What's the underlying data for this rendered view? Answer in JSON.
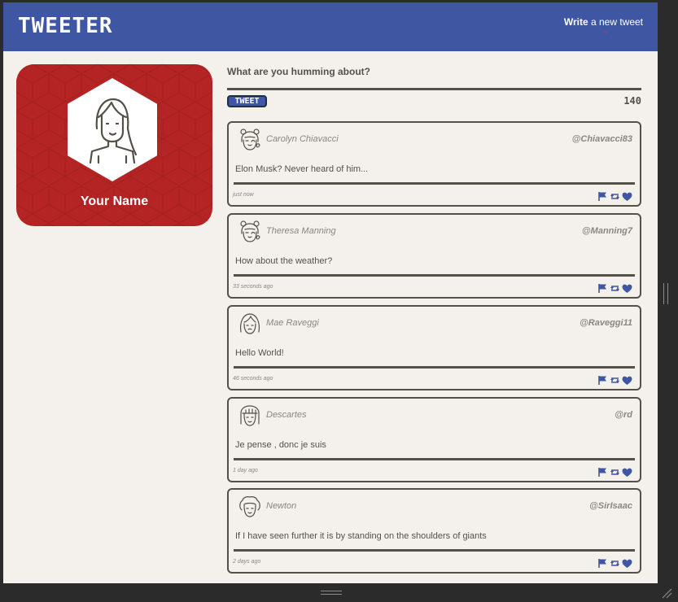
{
  "header": {
    "brand": "TWEETER",
    "write_bold": "Write",
    "write_rest": " a new tweet",
    "arrow": "⌄"
  },
  "profile": {
    "name": "Your Name"
  },
  "compose": {
    "label": "What are you humming about?",
    "placeholder": "",
    "button_label": "TWEET",
    "counter": "140"
  },
  "tweets": [
    {
      "name": "Carolyn Chiavacci",
      "handle": "@Chiavacci83",
      "content": "Elon Musk? Never heard of him...",
      "time": "just now"
    },
    {
      "name": "Theresa Manning",
      "handle": "@Manning7",
      "content": "How about the weather?",
      "time": "33 seconds ago"
    },
    {
      "name": "Mae Raveggi",
      "handle": "@Raveggi11",
      "content": "Hello World!",
      "time": "46 seconds ago"
    },
    {
      "name": "Descartes",
      "handle": "@rd",
      "content": "Je pense , donc je suis",
      "time": "1 day ago"
    },
    {
      "name": "Newton",
      "handle": "@SirIsaac",
      "content": "If I have seen further it is by standing on the shoulders of giants",
      "time": "2 days ago"
    }
  ],
  "icons": {
    "flag": "flag-icon",
    "retweet": "retweet-icon",
    "like": "heart-icon",
    "avatar": "avatar-icon"
  },
  "colors": {
    "navbar": "#3f57a2",
    "profile_bg": "#b52424",
    "page_bg": "#f4f1ec",
    "text_dark": "#545149",
    "text_muted": "#8a8680",
    "accent_red": "#c63a3a"
  }
}
